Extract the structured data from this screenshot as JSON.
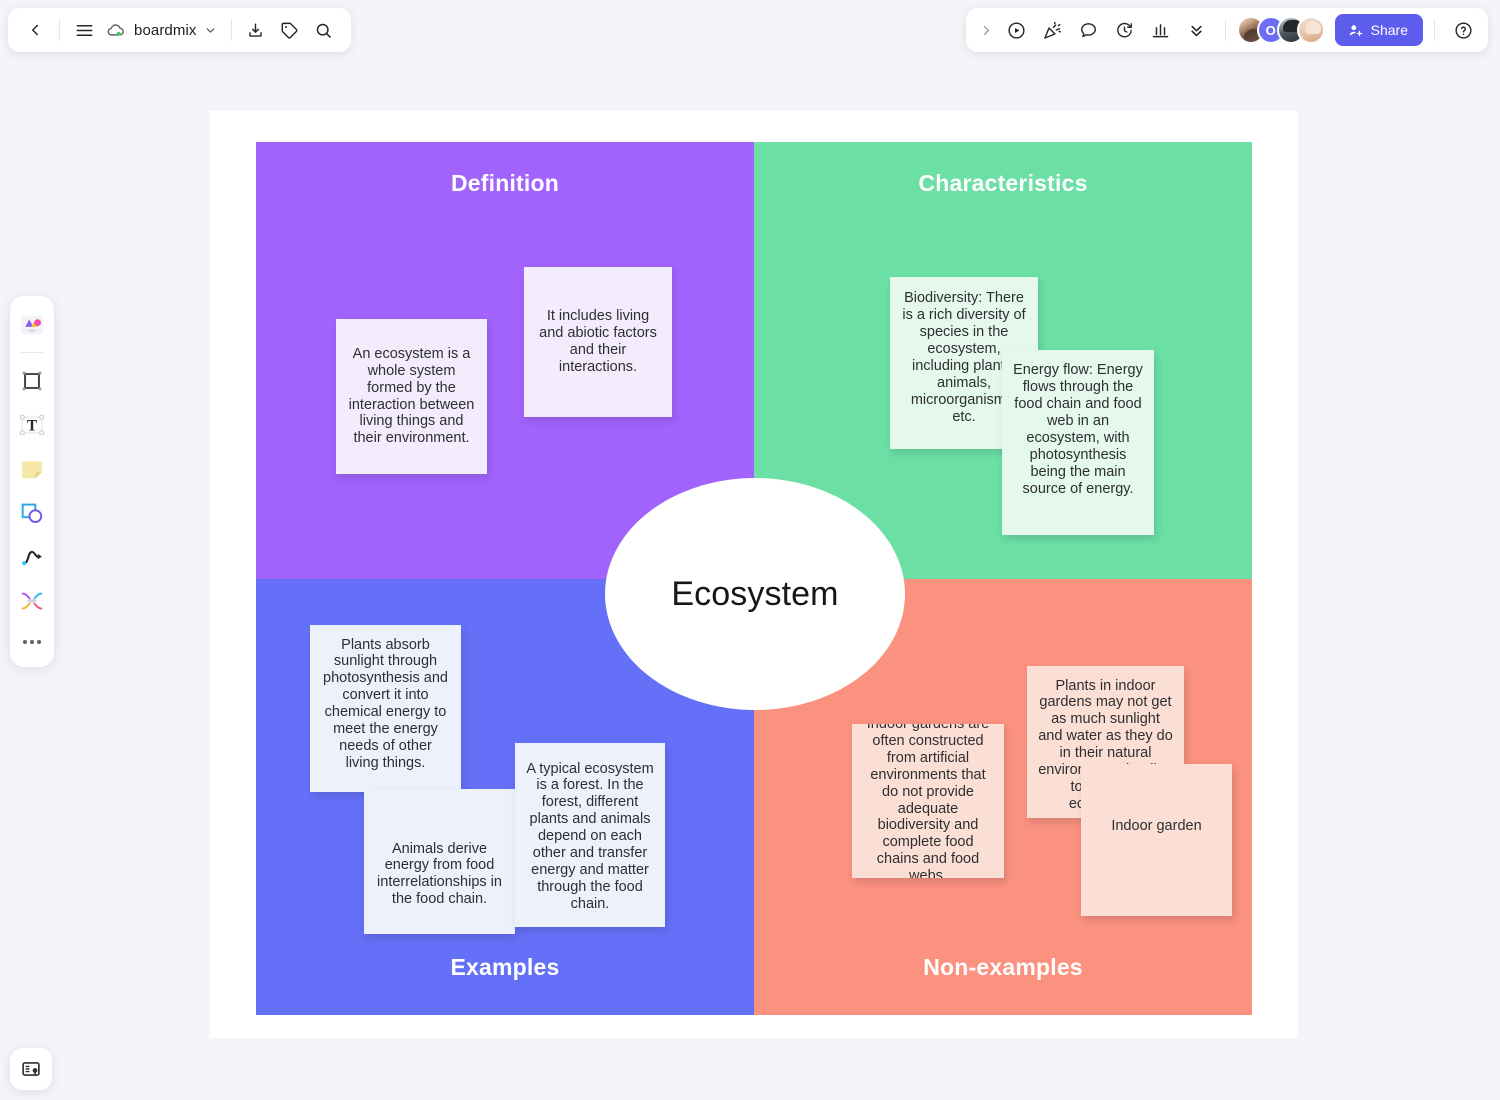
{
  "app": {
    "title": "boardmix",
    "canvas_bg": "#f5f4f9"
  },
  "top_left_toolbar": {
    "back_label": "Back",
    "menu_label": "Menu",
    "doc_name": "boardmix",
    "doc_chevron": "chevron-down",
    "export_label": "Export",
    "tag_label": "Tag",
    "search_label": "Search"
  },
  "top_right_toolbar": {
    "expand_label": "Expand",
    "present_label": "Present",
    "reactions_label": "Reactions",
    "comment_label": "Comment",
    "timer_label": "Timer",
    "vote_label": "Vote",
    "more_label": "More",
    "collaborators": [
      {
        "name": "collaborator-1",
        "initial": ""
      },
      {
        "name": "collaborator-2",
        "initial": "O"
      },
      {
        "name": "collaborator-3",
        "initial": ""
      },
      {
        "name": "collaborator-4",
        "initial": ""
      }
    ],
    "share_label": "Share",
    "help_label": "Help",
    "share_color": "#5c5ced"
  },
  "tool_rail": {
    "items": [
      {
        "name": "templates",
        "label": "Templates"
      },
      {
        "name": "frame",
        "label": "Frame"
      },
      {
        "name": "text",
        "label": "Text"
      },
      {
        "name": "sticky-note",
        "label": "Sticky note"
      },
      {
        "name": "shape",
        "label": "Shape"
      },
      {
        "name": "pen",
        "label": "Pen"
      },
      {
        "name": "connector",
        "label": "Connector"
      },
      {
        "name": "more",
        "label": "More tools"
      }
    ]
  },
  "bottom_left": {
    "board_settings_label": "Board settings"
  },
  "board": {
    "center_label": "Ecosystem",
    "colors": {
      "definition": "#a163fc",
      "characteristics": "#6bdfa4",
      "examples": "#6470f7",
      "non_examples": "#fb917f",
      "note_definition": "#f2ecfc",
      "note_characteristics": "#e4f8ec",
      "note_examples": "#edf1fb",
      "note_non_examples": "#fbdfd4",
      "frame": "#ffffff"
    },
    "quadrants": [
      {
        "key": "definition",
        "title": "Definition",
        "notes": [
          {
            "id": "def-note-1",
            "text": "An ecosystem is a whole system formed by the interaction between living things and their environment."
          },
          {
            "id": "def-note-2",
            "text": "It includes living and abiotic factors and their interactions."
          }
        ]
      },
      {
        "key": "characteristics",
        "title": "Characteristics",
        "notes": [
          {
            "id": "char-note-1",
            "text": "Biodiversity: There is a rich diversity of species in the ecosystem, including plants, animals, microorganisms, etc."
          },
          {
            "id": "char-note-2",
            "text": "Energy flow: Energy flows through the food chain and food web in an ecosystem, with photosynthesis being the main source of energy."
          }
        ]
      },
      {
        "key": "examples",
        "title": "Examples",
        "notes": [
          {
            "id": "ex-note-1",
            "text": "Plants absorb sunlight through photosynthesis and convert it into chemical energy to meet the energy needs of other living things."
          },
          {
            "id": "ex-note-2",
            "text": "Animals derive energy from food interrelationships in the food chain."
          },
          {
            "id": "ex-note-3",
            "text": "A typical ecosystem is a forest. In the forest, different plants and animals depend on each other and transfer energy and matter through the food chain."
          }
        ]
      },
      {
        "key": "non_examples",
        "title": "Non-examples",
        "notes": [
          {
            "id": "non-note-1",
            "text": "Indoor gardens are often constructed from artificial environments that do not provide adequate biodiversity and complete food chains and food webs."
          },
          {
            "id": "non-note-2",
            "text": "Plants in indoor gardens may not get as much sunlight and water as they do in their natural environment, leading to a loss of ecosystem."
          },
          {
            "id": "non-note-3",
            "text": "Indoor garden"
          }
        ]
      }
    ]
  }
}
